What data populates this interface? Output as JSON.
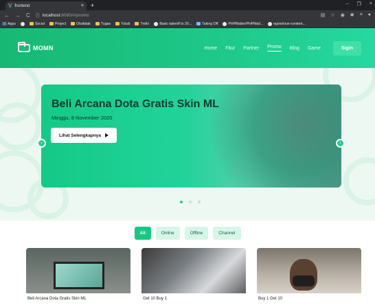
{
  "browser": {
    "tab_title": "frontend",
    "tab_close": "×",
    "new_tab": "+",
    "window_controls": [
      "–",
      "❐",
      "×"
    ],
    "url_host": "localhost",
    "url_path": ":8080/#/promo",
    "nav_buttons": [
      "←",
      "→",
      "C"
    ],
    "addr_icons": [
      "▤",
      "☆",
      "◉",
      "✱",
      "≡",
      "●"
    ],
    "bookmarks": [
      {
        "label": "Apps",
        "icon": "apps-icon"
      },
      {
        "label": "",
        "icon": "globe-icon"
      },
      {
        "label": "Social",
        "icon": "folder-icon"
      },
      {
        "label": "Project",
        "icon": "folder-icon"
      },
      {
        "label": "Otodidak",
        "icon": "folder-icon"
      },
      {
        "label": "Tugas",
        "icon": "folder-icon"
      },
      {
        "label": "Yutub",
        "icon": "folder-icon"
      },
      {
        "label": "Trello",
        "icon": "folder-icon"
      },
      {
        "label": "Basic takeoff to 20...",
        "icon": "github-icon"
      },
      {
        "label": "Taking Off",
        "icon": "bar-icon"
      },
      {
        "label": "PHPMailer/PHPMail...",
        "icon": "github-icon"
      },
      {
        "label": "egoist/vue-content...",
        "icon": "github-icon"
      }
    ]
  },
  "navbar": {
    "brand": "MOMN",
    "menu": [
      "Home",
      "Fitur",
      "Partner",
      "Promo",
      "Blog",
      "Game"
    ],
    "active_menu": "Promo",
    "signin": "Sigin"
  },
  "hero": {
    "title": "Beli Arcana Dota Gratis Skin ML",
    "date": "Minggu, 8 November 2020",
    "cta": "Lihat Selengkapnya",
    "prev_arrow": "‹",
    "next_arrow": "›",
    "slide_count": 3,
    "active_slide": 1
  },
  "filters": [
    "All",
    "Online",
    "Offline",
    "Channel"
  ],
  "active_filter": "All",
  "cards": [
    {
      "title": "Beli Arcana Dota Gratis Skin ML"
    },
    {
      "title": "Get 10 Buy 1"
    },
    {
      "title": "Buy 1 Get 10"
    }
  ],
  "colors": {
    "brand": "#16c983",
    "chip_bg": "#d6f6e8"
  }
}
